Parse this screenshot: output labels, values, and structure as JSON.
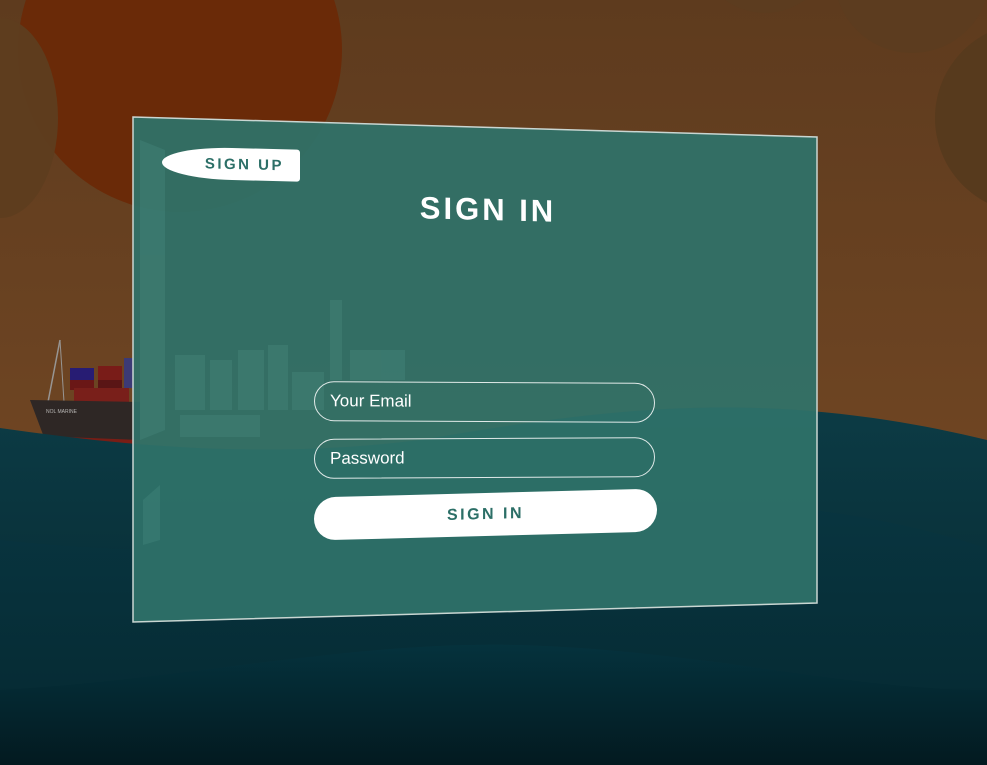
{
  "signup_button": {
    "label": "SIGN UP"
  },
  "form": {
    "title": "SIGN IN",
    "email_placeholder": "Your Email",
    "password_placeholder": "Password",
    "submit_label": "SIGN IN"
  },
  "colors": {
    "panel": "#2f7269",
    "accent_text": "#2c6f67",
    "sky": "#6b4324",
    "sun": "#6a2a08",
    "sea": "#073540"
  }
}
